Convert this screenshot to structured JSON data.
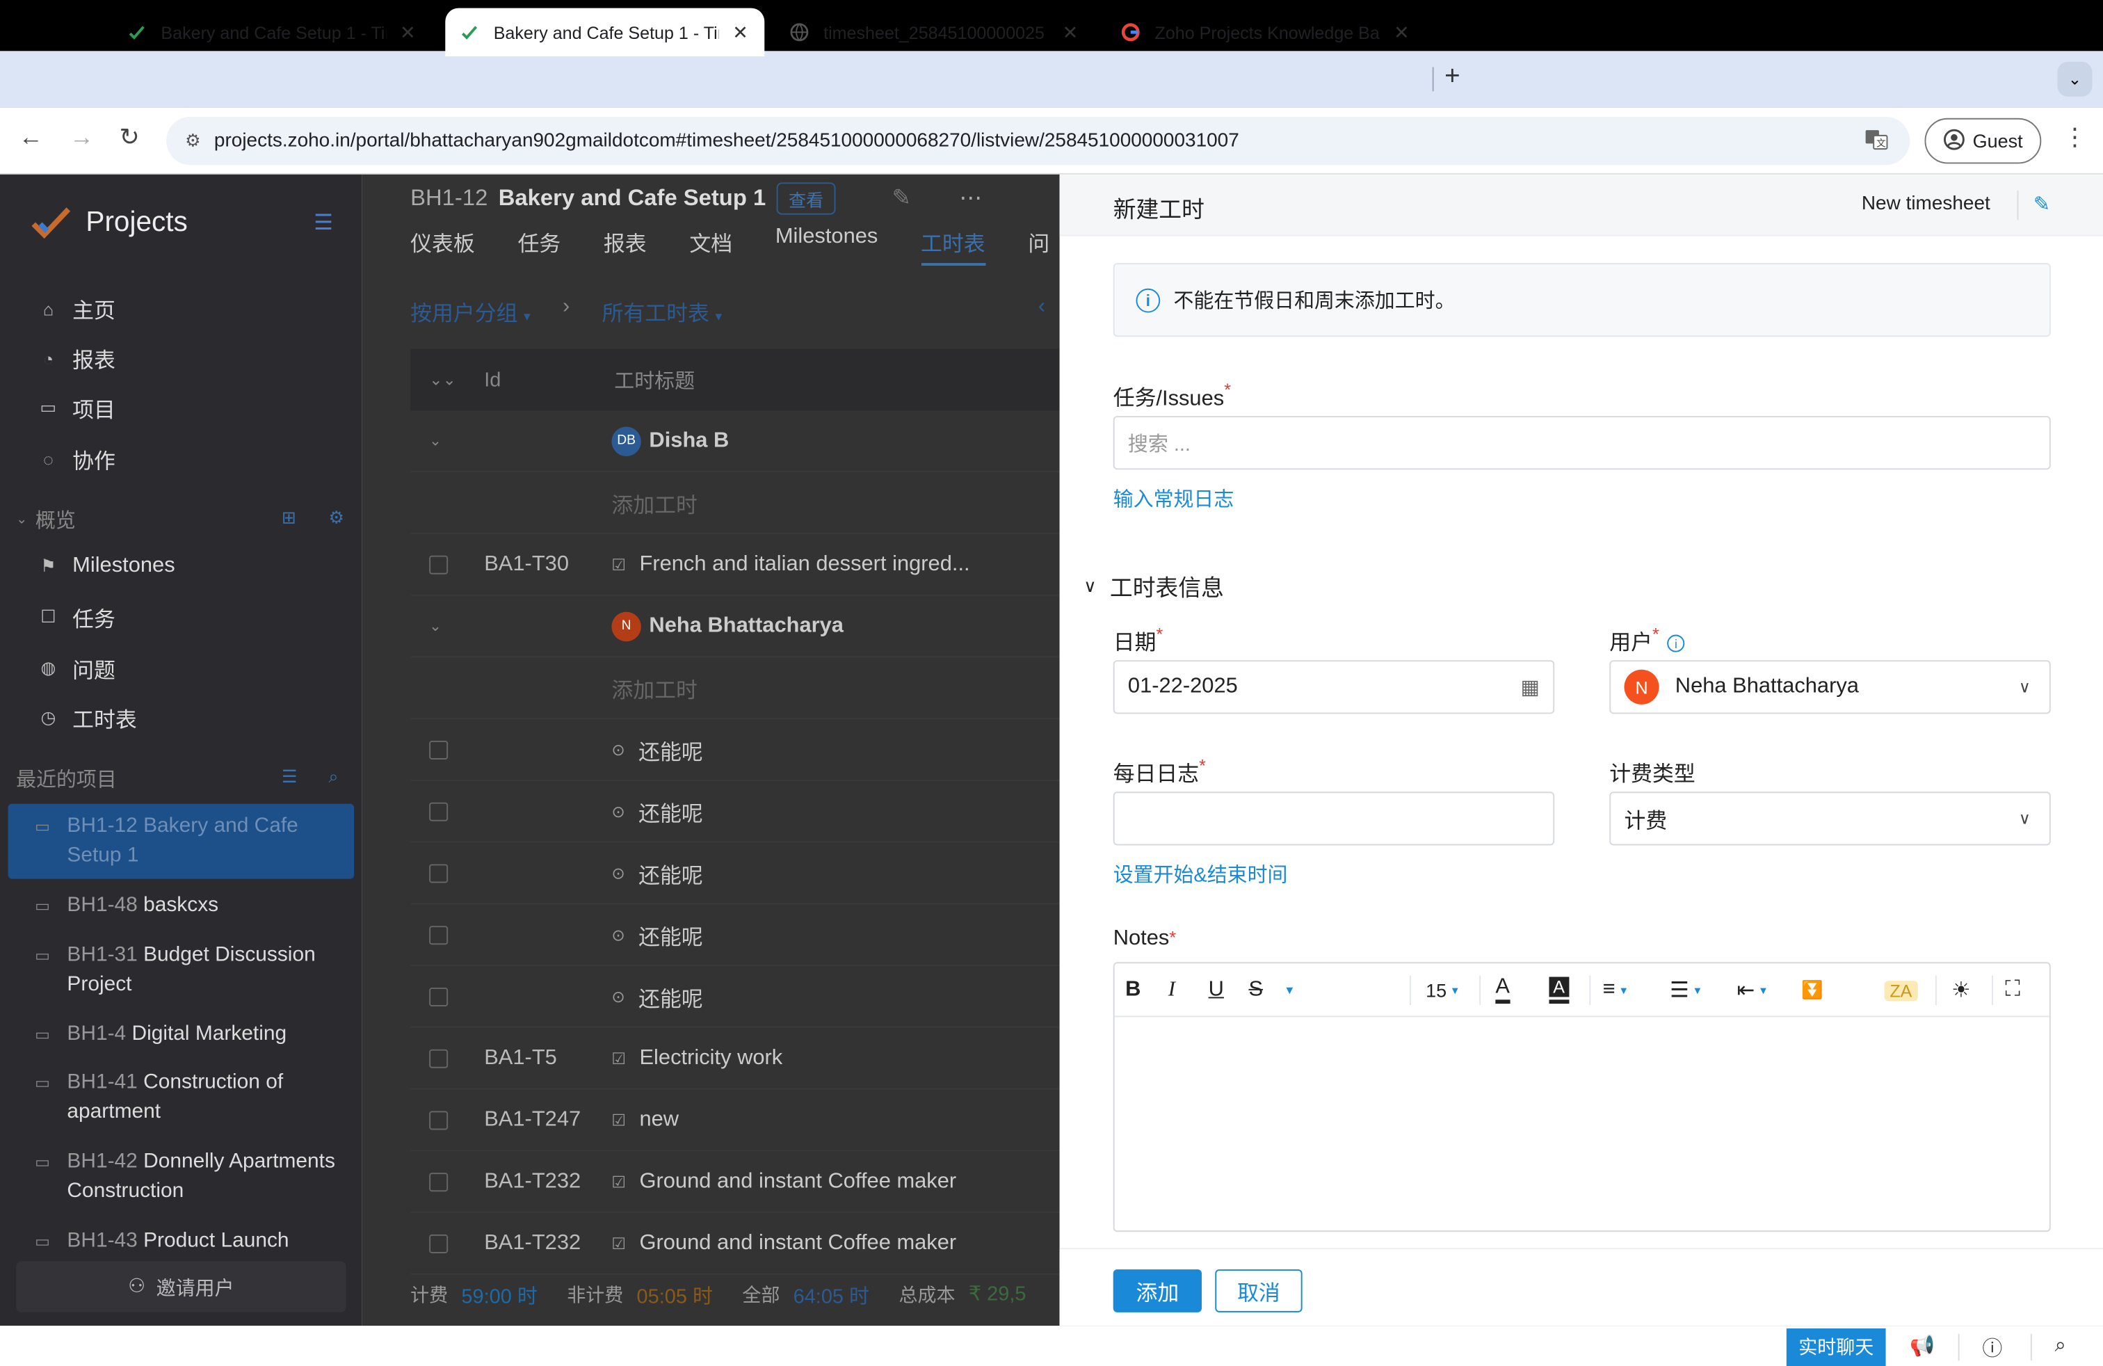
{
  "browser": {
    "tabs": [
      {
        "title": "Bakery and Cafe Setup 1 - Tin",
        "active": false
      },
      {
        "title": "Bakery and Cafe Setup 1 - Tin",
        "active": true
      },
      {
        "title": "timesheet_25845100000025",
        "active": false
      },
      {
        "title": "Zoho Projects Knowledge Bas",
        "active": false
      }
    ],
    "url": "projects.zoho.in/portal/bhattacharyan902gmaildotcom#timesheet/258451000000068270/listview/258451000000031007",
    "profile_label": "Guest"
  },
  "sidebar": {
    "brand": "Projects",
    "nav": [
      {
        "label": "主页",
        "icon": "home-icon"
      },
      {
        "label": "报表",
        "icon": "report-icon"
      },
      {
        "label": "项目",
        "icon": "folder-icon"
      },
      {
        "label": "协作",
        "icon": "collab-icon"
      }
    ],
    "overview_heading": "概览",
    "overview_items": [
      {
        "label": "Milestones",
        "icon": "flag-icon"
      },
      {
        "label": "任务",
        "icon": "task-icon"
      },
      {
        "label": "问题",
        "icon": "bug-icon"
      },
      {
        "label": "工时表",
        "icon": "clock-icon"
      }
    ],
    "recent_heading": "最近的项目",
    "recent_projects": [
      {
        "code": "BH1-12",
        "name": "Bakery and Cafe Setup 1",
        "selected": true
      },
      {
        "code": "BH1-48",
        "name": "baskcxs"
      },
      {
        "code": "BH1-31",
        "name": "Budget Discussion Project"
      },
      {
        "code": "BH1-4",
        "name": "Digital Marketing"
      },
      {
        "code": "BH1-41",
        "name": "Construction of apartment"
      },
      {
        "code": "BH1-42",
        "name": "Donnelly Apartments Construction"
      },
      {
        "code": "BH1-43",
        "name": "Product Launch"
      }
    ],
    "invite_label": "邀请用户"
  },
  "main": {
    "project_code": "BH1-12",
    "project_name": "Bakery and Cafe Setup 1",
    "view_label": "查看",
    "tabs": [
      "仪表板",
      "任务",
      "报表",
      "文档",
      "Milestones",
      "工时表",
      "问"
    ],
    "active_tab": "工时表",
    "group_filter": "按用户分组",
    "sheet_filter": "所有工时表",
    "columns": {
      "id": "Id",
      "title": "工时标题"
    },
    "rows": [
      {
        "type": "group",
        "label": "Disha B",
        "initials": "DB",
        "color": "#2c5b93"
      },
      {
        "type": "add",
        "label": "添加工时"
      },
      {
        "type": "item",
        "id": "BA1-T30",
        "title": "French and italian dessert ingred..."
      },
      {
        "type": "group",
        "label": "Neha Bhattacharya",
        "initials": "N",
        "color": "#b33d17"
      },
      {
        "type": "add",
        "label": "添加工时"
      },
      {
        "type": "item",
        "id": "",
        "title": "还能呢",
        "issue": true
      },
      {
        "type": "item",
        "id": "",
        "title": "还能呢",
        "issue": true
      },
      {
        "type": "item",
        "id": "",
        "title": "还能呢",
        "issue": true
      },
      {
        "type": "item",
        "id": "",
        "title": "还能呢",
        "issue": true
      },
      {
        "type": "item",
        "id": "",
        "title": "还能呢",
        "issue": true
      },
      {
        "type": "item",
        "id": "BA1-T5",
        "title": "Electricity work"
      },
      {
        "type": "item",
        "id": "BA1-T247",
        "title": "new"
      },
      {
        "type": "item",
        "id": "BA1-T232",
        "title": "Ground and instant Coffee maker"
      },
      {
        "type": "item",
        "id": "BA1-T232",
        "title": "Ground and instant Coffee maker"
      }
    ],
    "footer": {
      "billable_label": "计费",
      "billable_value": "59:00 时",
      "nonbillable_label": "非计费",
      "nonbillable_value": "05:05 时",
      "total_label": "全部",
      "total_value": "64:05 时",
      "cost_label": "总成本",
      "cost_value": "₹ 29,5"
    }
  },
  "drawer": {
    "title": "新建工时",
    "layout_name": "New timesheet",
    "notice": "不能在节假日和周末添加工时。",
    "task_label": "任务/Issues",
    "task_placeholder": "搜索 ...",
    "general_log_link": "输入常规日志",
    "section_title": "工时表信息",
    "date_label": "日期",
    "date_value": "01-22-2025",
    "user_label": "用户",
    "user_value": "Neha Bhattacharya",
    "user_initial": "N",
    "daily_log_label": "每日日志",
    "daily_log_value": "",
    "billing_label": "计费类型",
    "billing_value": "计费",
    "start_end_link": "设置开始&结束时间",
    "notes_label": "Notes",
    "font_size": "15",
    "add_button": "添加",
    "cancel_button": "取消"
  },
  "bottom": {
    "chat_label": "实时聊天"
  }
}
